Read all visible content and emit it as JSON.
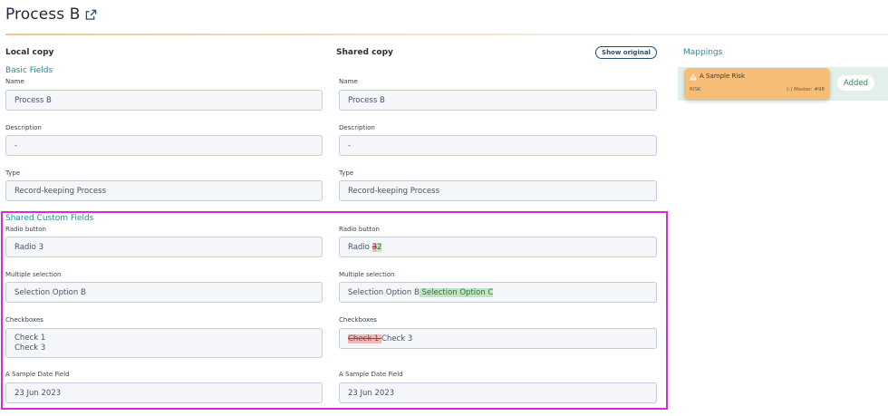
{
  "page": {
    "title": "Process B"
  },
  "columns": {
    "local": "Local copy",
    "shared": "Shared copy",
    "mappings": "Mappings"
  },
  "show_original_label": "Show original",
  "sections": {
    "basic": "Basic Fields",
    "custom": "Shared Custom Fields"
  },
  "fields": {
    "name": {
      "label": "Name",
      "local": "Process B",
      "shared": "Process B"
    },
    "description": {
      "label": "Description",
      "local": "-",
      "shared": "-"
    },
    "type": {
      "label": "Type",
      "local": "Record-keeping Process",
      "shared": "Record-keeping Process"
    },
    "radio": {
      "label": "Radio button",
      "local": "Radio 3",
      "shared_prefix": "Radio ",
      "shared_removed": "3",
      "shared_added": "2"
    },
    "multi": {
      "label": "Multiple selection",
      "local": "Selection Option B",
      "shared_prefix": "Selection Option B",
      "shared_added": " Selection Option C"
    },
    "checkboxes": {
      "label": "Checkboxes",
      "local_1": "Check 1",
      "local_2": "Check 3",
      "shared_removed": "Check 1 ",
      "shared_kept": "Check 3"
    },
    "date": {
      "label": "A Sample Date Field",
      "local": "23 Jun 2023",
      "shared": "23 Jun 2023"
    }
  },
  "mapping": {
    "name": "A Sample Risk",
    "type": "RISK",
    "ref": "(-) Master: #98",
    "status": "Added"
  },
  "colors": {
    "accent": "#2a8a9a",
    "risk_card": "#f6bd76",
    "highlight": "#d92ad9",
    "added_bg": "#bfe6c3",
    "removed_bg": "#f2b8b8"
  },
  "icons": {
    "title": "external-link-icon",
    "risk": "warning-icon"
  }
}
